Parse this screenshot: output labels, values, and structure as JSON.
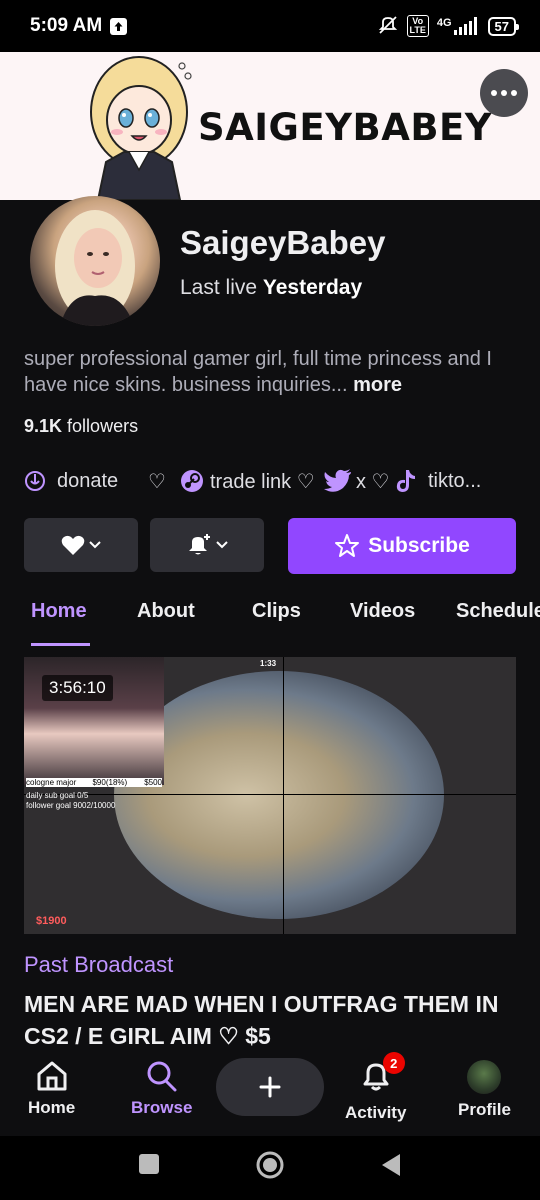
{
  "status_bar": {
    "time": "5:09 AM",
    "lte_label": "Vo\nLTE",
    "network": "4G",
    "battery": "57"
  },
  "banner": {
    "title": "SAIGEYBABEY"
  },
  "profile": {
    "channel_name": "SaigeyBabey",
    "last_live_prefix": "Last live",
    "last_live_value": "Yesterday",
    "bio": "super professional gamer girl, full time princess and I have nice skins. business inquiries...",
    "bio_more": "more",
    "followers_count": "9.1K",
    "followers_label": "followers"
  },
  "links": [
    {
      "icon": "donate-icon",
      "label": "donate"
    },
    {
      "icon": "heart-outline-icon",
      "label": "♡"
    },
    {
      "icon": "steam-icon",
      "label": "trade link ♡"
    },
    {
      "icon": "twitter-icon",
      "label": "x ♡"
    },
    {
      "icon": "tiktok-icon",
      "label": "tikto..."
    }
  ],
  "actions": {
    "subscribe_label": "Subscribe"
  },
  "tabs": [
    {
      "label": "Home",
      "active": true
    },
    {
      "label": "About",
      "active": false
    },
    {
      "label": "Clips",
      "active": false
    },
    {
      "label": "Videos",
      "active": false
    },
    {
      "label": "Schedule",
      "active": false
    }
  ],
  "video": {
    "duration": "3:56:10",
    "overlay": {
      "goal_name": "cologne major",
      "goal_progress": "$90(18%)",
      "goal_target": "$500",
      "sub_goal": "daily sub goal 0/5",
      "follower_goal": "follower goal 9002/10000",
      "money": "$1900",
      "round_time": "1:33"
    },
    "category": "Past Broadcast",
    "title": "MEN ARE MAD WHEN I OUTFRAG THEM IN CS2 / E GIRL AIM ♡ $5"
  },
  "bottom_nav": [
    {
      "label": "Home",
      "icon": "home-icon",
      "active": false
    },
    {
      "label": "Browse",
      "icon": "search-icon",
      "active": true
    },
    {
      "label": "Activity",
      "icon": "bell-icon",
      "active": false,
      "badge": "2"
    },
    {
      "label": "Profile",
      "icon": "profile-avatar",
      "active": false
    }
  ],
  "colors": {
    "background": "#0e0e10",
    "accent": "#9147ff",
    "accent_light": "#bf94ff",
    "button_dark": "#2f2f35",
    "badge_red": "#eb0400"
  }
}
